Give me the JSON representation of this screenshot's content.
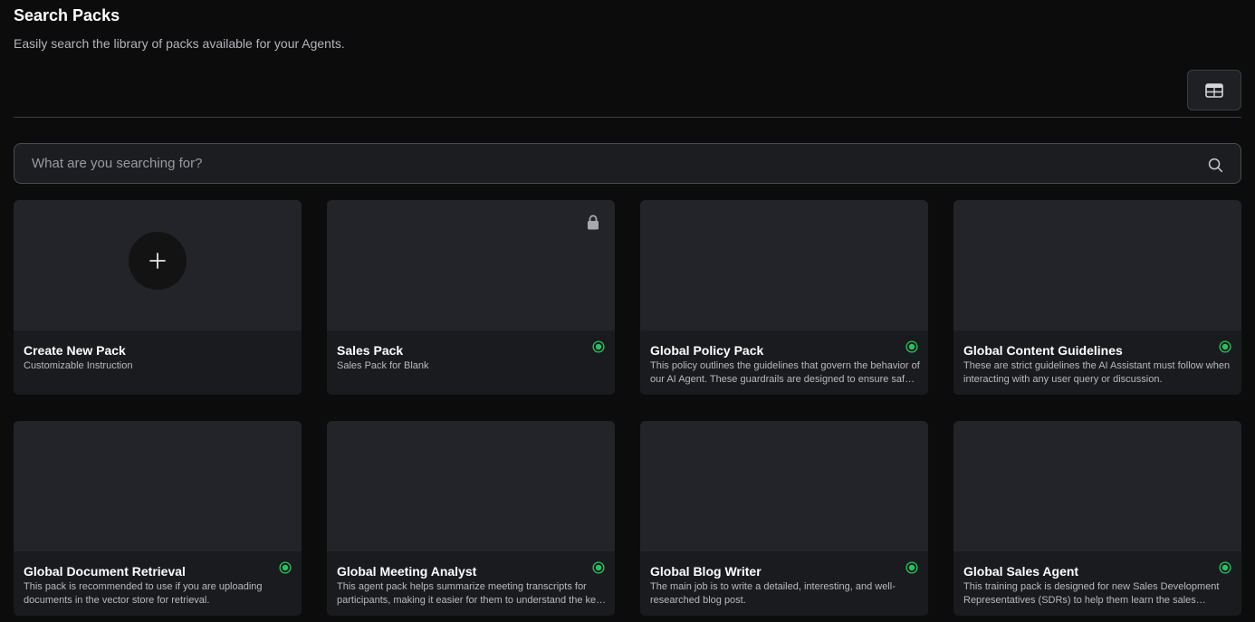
{
  "header": {
    "title": "Search Packs",
    "subtitle": "Easily search the library of packs available for your Agents."
  },
  "toolbar": {
    "view_toggle_icon": "table-icon"
  },
  "search": {
    "placeholder": "What are you searching for?",
    "value": "",
    "icon": "search-icon"
  },
  "colors": {
    "background": "#0c0c0d",
    "card": "#232429",
    "card_info": "#1a1b1e",
    "status_active": "#22c55e"
  },
  "create_card": {
    "title": "Create New Pack",
    "description": "Customizable Instruction",
    "icon": "plus-icon"
  },
  "packs": [
    {
      "title": "Sales Pack",
      "description": "Sales Pack for Blank",
      "status": "active",
      "locked": true
    },
    {
      "title": "Global Policy Pack",
      "description": "This policy outlines the guidelines that govern the behavior of our AI Agent. These guardrails are designed to ensure safe and responsible responses.",
      "status": "active",
      "locked": false
    },
    {
      "title": "Global Content Guidelines",
      "description": "These are strict guidelines the AI Assistant must follow when interacting with any user query or discussion.",
      "status": "active",
      "locked": false
    },
    {
      "title": "Global Document Retrieval",
      "description": "This pack is recommended to use if you are uploading documents in the vector store for retrieval.",
      "status": "active",
      "locked": false
    },
    {
      "title": "Global Meeting Analyst",
      "description": "This agent pack helps summarize meeting transcripts for participants, making it easier for them to understand the key points discussed.",
      "status": "active",
      "locked": false
    },
    {
      "title": "Global Blog Writer",
      "description": "The main job is to write a detailed, interesting, and well-researched blog post.",
      "status": "active",
      "locked": false
    },
    {
      "title": "Global Sales Agent",
      "description": "This training pack is designed for new Sales Development Representatives (SDRs) to help them learn the sales process.",
      "status": "active",
      "locked": false
    }
  ]
}
